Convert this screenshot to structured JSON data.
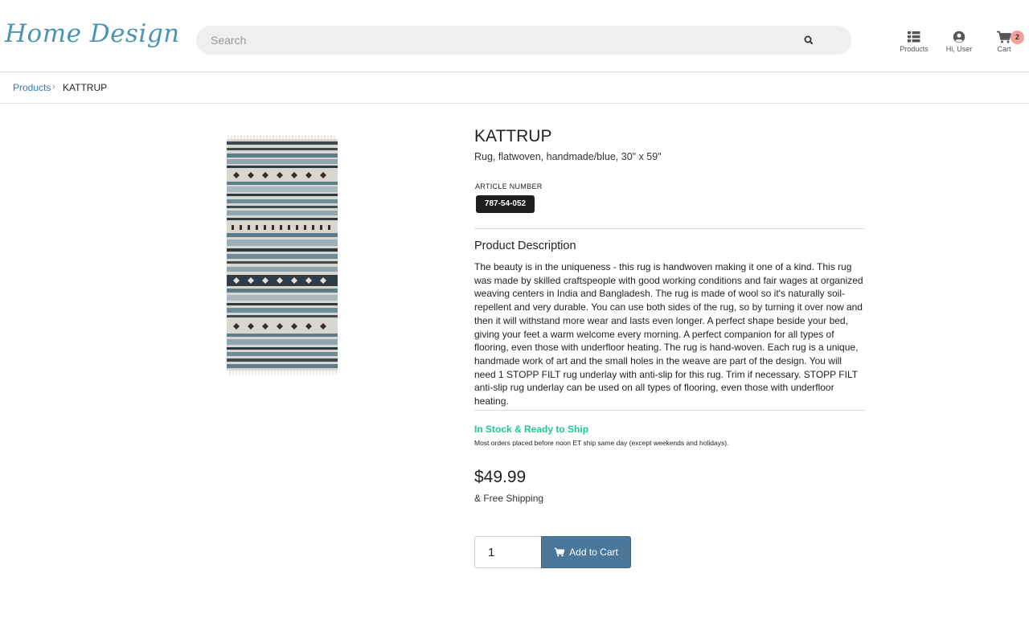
{
  "brand": {
    "logo_text": "Home Design",
    "color": "#4a93b3"
  },
  "search": {
    "placeholder": "Search",
    "value": "",
    "icon": "search-icon"
  },
  "nav": {
    "products_label": "Products",
    "user_label": "Hi, User",
    "cart_label": "Cart",
    "cart_count": "2"
  },
  "breadcrumb": {
    "parent": "Products",
    "separator": "›",
    "current": "KATTRUP"
  },
  "product": {
    "name": "KATTRUP",
    "subtitle": "Rug, flatwoven, handmade/blue, 30\" x 59\"",
    "article_label": "ARTICLE NUMBER",
    "article_number": "787-54-052",
    "description_heading": "Product Description",
    "description": "The beauty is in the uniqueness - this rug is handwoven making it one of a kind. This rug was made by skilled craftspeople with good working conditions and fair wages at organized weaving centers in India and Bangladesh. The rug is made of wool so it's naturally soil-repellent and very durable. You can use both sides of the rug, so by turning it over now and then it will withstand more wear and lasts even longer. A perfect shape beside your bed, giving your feet a warm welcome every morning. A perfect companion for all types of flooring, even those with underfloor heating. The rug is hand-woven. Each rug is a unique, handmade work of art and the small holes in the weave are part of the design. You will need 1 STOPP FILT rug underlay with anti-slip for this rug. Trim if necessary. STOPP FILT anti-slip rug underlay can be used on all types of flooring, even those with underfloor heating.",
    "stock_status": "In Stock & Ready to Ship",
    "stock_note": "Most orders placed before noon ET ship same day (except weekends and holidays).",
    "price": "$49.99",
    "shipping": "& Free Shipping",
    "quantity": "1",
    "add_to_cart_label": "Add to Cart"
  },
  "colors": {
    "accent": "#4a779a",
    "link": "#2f7bbf",
    "in_stock": "#1ec799",
    "badge": "#f4a09a"
  }
}
